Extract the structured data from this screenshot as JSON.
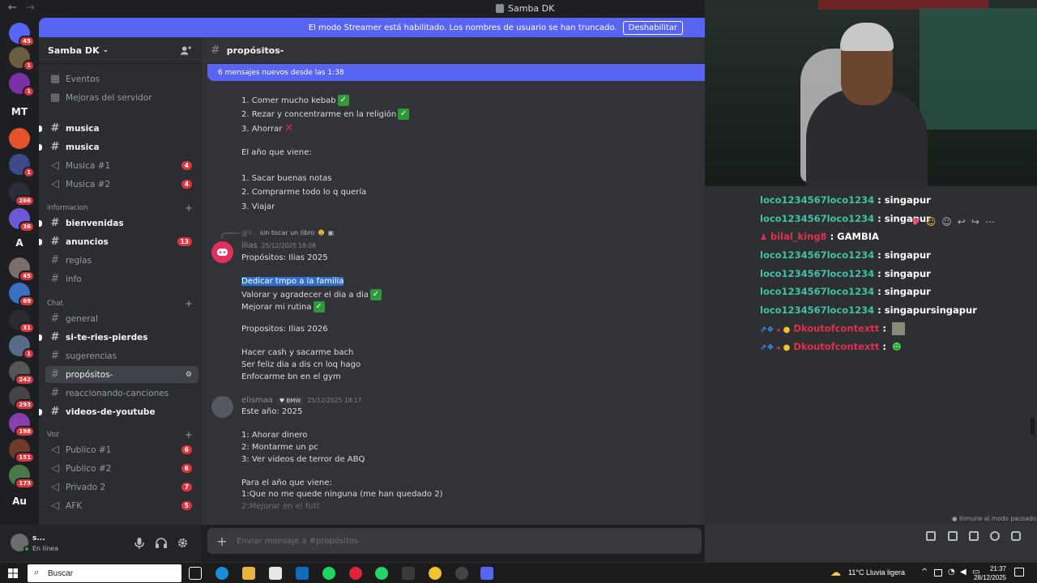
{
  "window": {
    "title": "Samba DK"
  },
  "streamer_banner": {
    "text": "El modo Streamer está habilitado. Los nombres de usuario se han truncado.",
    "button": "Deshabilitar"
  },
  "guilds": [
    {
      "badge": "45"
    },
    {
      "badge": "1"
    },
    {
      "badge": "1"
    },
    {
      "label": "MT"
    },
    {
      "badge": ""
    },
    {
      "badge": "1"
    },
    {
      "badge": "266"
    },
    {
      "badge": "36"
    },
    {
      "label": "A"
    },
    {
      "badge": "45"
    },
    {
      "badge": "69"
    },
    {
      "badge": "31"
    },
    {
      "badge": "1"
    },
    {
      "badge": "242"
    },
    {
      "badge": "293"
    },
    {
      "badge": "198"
    },
    {
      "badge": "151"
    },
    {
      "badge": "173"
    },
    {
      "label": "Au"
    }
  ],
  "server": {
    "name": "Samba DK"
  },
  "sidebar": {
    "top": [
      {
        "label": "Eventos"
      },
      {
        "label": "Mejoras del servidor"
      }
    ],
    "channels1": [
      {
        "label": "musica",
        "type": "text",
        "bold": true
      },
      {
        "label": "musica",
        "type": "text",
        "bold": true
      },
      {
        "label": "Musica #1",
        "type": "voice",
        "count": "4"
      },
      {
        "label": "Musica #2",
        "type": "voice",
        "count": "4"
      }
    ],
    "cat_info": "informacion",
    "channels2": [
      {
        "label": "bienvenidas",
        "type": "text",
        "bold": true
      },
      {
        "label": "anuncios",
        "type": "text",
        "bold": true,
        "count": "13"
      },
      {
        "label": "reglas",
        "type": "text"
      },
      {
        "label": "info",
        "type": "text"
      }
    ],
    "cat_chat": "Chat",
    "channels3": [
      {
        "label": "general",
        "type": "text"
      },
      {
        "label": "si-te-ries-pierdes",
        "type": "text",
        "bold": true
      },
      {
        "label": "sugerencias",
        "type": "text"
      },
      {
        "label": "propósitos-",
        "type": "text",
        "active": true
      },
      {
        "label": "reaccionando-canciones",
        "type": "text"
      },
      {
        "label": "videos-de-youtube",
        "type": "text",
        "bold": true
      }
    ],
    "cat_voz": "Voz",
    "channels4": [
      {
        "label": "Publico #1",
        "type": "voice",
        "count": "6"
      },
      {
        "label": "Publico #2",
        "type": "voice",
        "count": "6"
      },
      {
        "label": "Privado 2",
        "type": "voice",
        "count": "7"
      },
      {
        "label": "AFK",
        "type": "voice",
        "count": "5"
      }
    ]
  },
  "user": {
    "name": "s...",
    "status": "En línea"
  },
  "channel": {
    "name": "propósitos-",
    "new_messages": "6 mensajes nuevos desde las 1:38"
  },
  "messages": {
    "block1": [
      {
        "text": "1. Comer mucho kebab",
        "mark": "check"
      },
      {
        "text": "2. Rezar y concentrarme en la religión",
        "mark": "check"
      },
      {
        "text": "3. Ahorrar",
        "mark": "cross"
      },
      {
        "text": "El año que viene:"
      },
      {
        "text": "1. Sacar buenas notas"
      },
      {
        "text": "2. Comprarme todo lo q quería"
      },
      {
        "text": "3. Viajar"
      }
    ],
    "reply": {
      "user": "@Y...",
      "text": "sin tocar un libro"
    },
    "ilias": {
      "author": "ilias",
      "time": "25/12/2025 18:08",
      "lines": [
        {
          "text": "Propósitos: Ilias 2025"
        },
        {
          "text": "Dedicar tmpo a la familia",
          "highlight": true
        },
        {
          "text": "Valorar y agradecer el dia a dia",
          "mark": "check"
        },
        {
          "text": "Mejorar mi rutina",
          "mark": "check"
        },
        {
          "text": "Propositos: Ilias 2026"
        },
        {
          "text": "Hacer cash y sacarme bach"
        },
        {
          "text": "Ser feliz dia a dis cn loq hago"
        },
        {
          "text": "Enfocarme bn en el gym"
        }
      ]
    },
    "elismaa": {
      "author": "elismaa",
      "tag": "BMW",
      "time": "25/12/2025 18:17",
      "lines": [
        {
          "text": "Este año: 2025"
        },
        {
          "text": "1: Ahorar dinero"
        },
        {
          "text": "2: Montarme un pc"
        },
        {
          "text": "3: Ver videos de terror de ABQ"
        },
        {
          "text": "Para el año que viene:"
        },
        {
          "text": "1:Que no me quede ninguna (me  han quedado 2)"
        },
        {
          "text": "2:Mejorar en el futt"
        }
      ]
    }
  },
  "composer": {
    "placeholder": "Enviar mensaje a #propósitos-"
  },
  "chat_status": "Inmune al modo pausado",
  "stream_chat": [
    {
      "user": "loco1234567loco1234",
      "msg": "singapur",
      "color": "#3fc3a1"
    },
    {
      "user": "loco1234567loco1234",
      "msg": "singapur",
      "color": "#3fc3a1"
    },
    {
      "user": "bilal_king8",
      "msg": "GAMBIA",
      "color": "#e0304a"
    },
    {
      "user": "loco1234567loco1234",
      "msg": "singapur",
      "color": "#3fc3a1"
    },
    {
      "user": "loco1234567loco1234",
      "msg": "singapur",
      "color": "#3fc3a1"
    },
    {
      "user": "loco1234567loco1234",
      "msg": "singapur",
      "color": "#3fc3a1"
    },
    {
      "user": "loco1234567loco1234",
      "msg": "singapursingapur",
      "color": "#3fc3a1"
    },
    {
      "user": "Dkoutofcontextt",
      "msg": "",
      "color": "#e0304a"
    },
    {
      "user": "Dkoutofcontextt",
      "msg": "",
      "color": "#e0304a"
    }
  ],
  "taskbar": {
    "search": "Buscar",
    "weather": "11°C  Lluvia ligera",
    "time": "21:37",
    "date": "28/12/2025"
  }
}
